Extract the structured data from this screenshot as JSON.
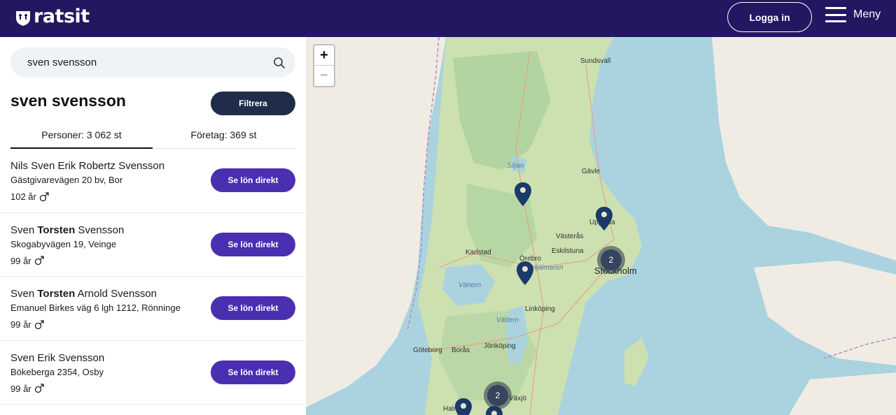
{
  "header": {
    "logo": "ratsit",
    "login_label": "Logga in",
    "menu_label": "Meny",
    "bg_color": "#231761"
  },
  "search": {
    "value": "sven svensson",
    "placeholder": ""
  },
  "results": {
    "heading": "sven svensson",
    "filter_label": "Filtrera",
    "tabs": [
      {
        "label": "Personer: 3 062 st",
        "active": true
      },
      {
        "label": "Företag: 369 st",
        "active": false
      }
    ],
    "persons": [
      {
        "name_pre": "Nils Sven Erik Robertz Svensson",
        "name_bold": "",
        "name_post": "",
        "address": "Gästgivarevägen 20 bv, Bor",
        "age": "102 år",
        "button": "Se lön direkt"
      },
      {
        "name_pre": "Sven ",
        "name_bold": "Torsten",
        "name_post": " Svensson",
        "address": "Skogabyvägen 19, Veinge",
        "age": "99 år",
        "button": "Se lön direkt"
      },
      {
        "name_pre": "Sven ",
        "name_bold": "Torsten",
        "name_post": " Arnold Svensson",
        "address": "Emanuel Birkes väg 6 lgh 1212, Rönninge",
        "age": "99 år",
        "button": "Se lön direkt"
      },
      {
        "name_pre": "Sven Erik Svensson",
        "name_bold": "",
        "name_post": "",
        "address": "Bökeberga 2354, Osby",
        "age": "99 år",
        "button": "Se lön direkt"
      }
    ],
    "button_color": "#4a2fb0"
  },
  "map": {
    "zoom_in": "+",
    "zoom_out": "−",
    "places": [
      "Sundsvall",
      "Siljan",
      "Gävle",
      "Uppsala",
      "Västerås",
      "Eskilstuna",
      "Karlstad",
      "Örebro",
      "Hjälmaren",
      "Stockholm",
      "Vänern",
      "Linköping",
      "Vättern",
      "Göteborg",
      "Borås",
      "Jönköping",
      "Växjö",
      "Halm"
    ],
    "clusters": [
      "2",
      "2"
    ],
    "marker_color": "#1a3a6b"
  }
}
